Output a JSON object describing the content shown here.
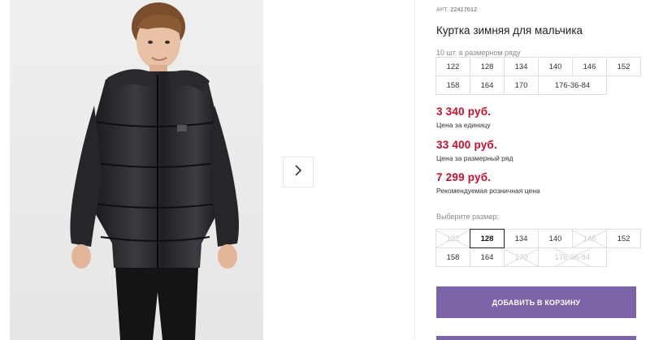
{
  "gallery": {
    "next_icon": "chevron-right-icon",
    "image_alt": "photo of a boy wearing a black winter jacket"
  },
  "product": {
    "sku_label": "АРТ.",
    "sku": "22417012",
    "title": "Куртка зимняя для мальчика",
    "size_row_caption": "10 шт. в размерном ряду",
    "size_row": [
      "122",
      "128",
      "134",
      "140",
      "146",
      "152",
      "158",
      "164",
      "170",
      "176-36-84"
    ]
  },
  "prices": {
    "unit_price": "3 340 руб.",
    "unit_caption": "Цена за единицу",
    "row_price": "33 400 руб.",
    "row_caption": "Цена за размерный ряд",
    "retail_price": "7 299 руб.",
    "retail_caption": "Рекомендуемая розничная цена",
    "price_color": "#c8102e"
  },
  "size_select": {
    "label": "Выберите размер:",
    "options": [
      {
        "value": "122",
        "available": false,
        "selected": false
      },
      {
        "value": "128",
        "available": true,
        "selected": true
      },
      {
        "value": "134",
        "available": true,
        "selected": false
      },
      {
        "value": "140",
        "available": true,
        "selected": false
      },
      {
        "value": "146",
        "available": false,
        "selected": false
      },
      {
        "value": "152",
        "available": true,
        "selected": false
      },
      {
        "value": "158",
        "available": true,
        "selected": false
      },
      {
        "value": "164",
        "available": true,
        "selected": false
      },
      {
        "value": "170",
        "available": false,
        "selected": false
      },
      {
        "value": "176-36-84",
        "available": false,
        "selected": false
      }
    ]
  },
  "cart": {
    "add_label": "ДОБАВИТЬ В КОРЗИНУ",
    "accent_color": "#7b64a8"
  }
}
